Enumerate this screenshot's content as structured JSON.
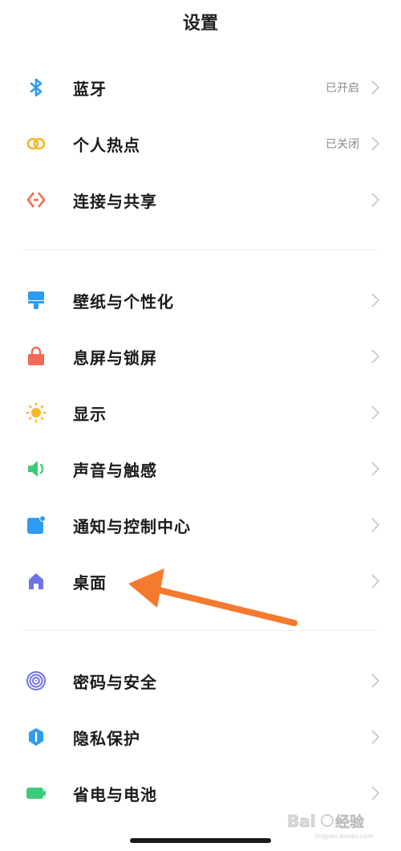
{
  "header": {
    "title": "设置"
  },
  "colors": {
    "accent_arrow": "#F47A2E",
    "bluetooth": "#2E9BF0",
    "hotspot": "#F2B824",
    "share": "#F26A4F",
    "wallpaper": "#2E9BF0",
    "lock": "#F26A55",
    "display": "#F5B82C",
    "sound": "#3DCB7A",
    "notify": "#2E9BF0",
    "desktop": "#6D72E8",
    "password": "#6D72E8",
    "privacy": "#2E9BF0",
    "battery": "#3DCB7A"
  },
  "sections": {
    "connectivity": [
      {
        "label": "蓝牙",
        "status": "已开启",
        "icon": "bluetooth-icon"
      },
      {
        "label": "个人热点",
        "status": "已关闭",
        "icon": "hotspot-icon"
      },
      {
        "label": "连接与共享",
        "status": "",
        "icon": "share-icon"
      }
    ],
    "personal": [
      {
        "label": "壁纸与个性化",
        "icon": "wallpaper-icon"
      },
      {
        "label": "息屏与锁屏",
        "icon": "lock-icon"
      },
      {
        "label": "显示",
        "icon": "sun-icon"
      },
      {
        "label": "声音与触感",
        "icon": "speaker-icon"
      },
      {
        "label": "通知与控制中心",
        "icon": "notification-icon"
      },
      {
        "label": "桌面",
        "icon": "home-icon"
      }
    ],
    "security": [
      {
        "label": "密码与安全",
        "icon": "fingerprint-icon"
      },
      {
        "label": "隐私保护",
        "icon": "shield-icon"
      },
      {
        "label": "省电与电池",
        "icon": "battery-icon"
      }
    ]
  },
  "watermark": {
    "text": "Bai经验",
    "subtext": "jingyan.baidu.com"
  }
}
